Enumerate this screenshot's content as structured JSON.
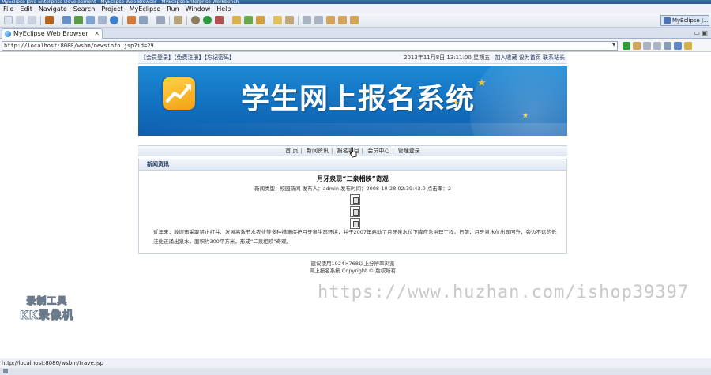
{
  "window": {
    "title": "MyEclipse Java Enterprise Development - MyEclipse Web Browser - MyEclipse Enterprise Workbench"
  },
  "menu": [
    "File",
    "Edit",
    "Navigate",
    "Search",
    "Project",
    "MyEclipse",
    "Run",
    "Window",
    "Help"
  ],
  "perspective": {
    "label": "MyEclipse J..."
  },
  "tab": {
    "label": "MyEclipse Web Browser",
    "close": "✕"
  },
  "browser": {
    "url": "http://localhost:8080/wsbm/newsinfo.jsp?id=29",
    "status": "http://localhost:8080/wsbm/trave.jsp"
  },
  "site": {
    "top_links": [
      "【会员登录】",
      "【免费注册】",
      "【忘记密码】"
    ],
    "date": "2013年11月8日 13:11:00  星期五",
    "top_right": [
      "加入收藏",
      "设为首页",
      "联系站长"
    ],
    "banner_title": "学生网上报名系统",
    "nav": [
      "首 页",
      "新闻资讯",
      "报名项目",
      "会员中心",
      "管理登录"
    ],
    "news": {
      "section": "新闻资讯",
      "title": "月牙泉现“二泉相映”奇观",
      "meta": "新闻类型：校园新闻 发布人：admin 发布时间：2008-10-28 02:39:43.0 点击率：2",
      "body": "近年来，敦煌市采取禁止打井、发展高效节水农业等多种措施保护月牙泉生态环境，并于2007年启动了月牙泉水位下降应急治理工程。日前，月牙泉水位出现回升，旁边不远的低洼处还涌出泉水，面积约300平方米，形成“二泉相映”奇观。"
    },
    "footer": [
      "建议使用1024×768以上分辨率浏览",
      "网上报名系统 Copyright © 版权所有"
    ]
  },
  "overlay": {
    "watermark": "https://www.huzhan.com/ishop39397",
    "kk_line1": "录制工具",
    "kk_line2": "KK录像机"
  },
  "colors": {
    "banner": "#1475c4",
    "chrome": "#eef1f7",
    "link": "#1c2e5a"
  }
}
